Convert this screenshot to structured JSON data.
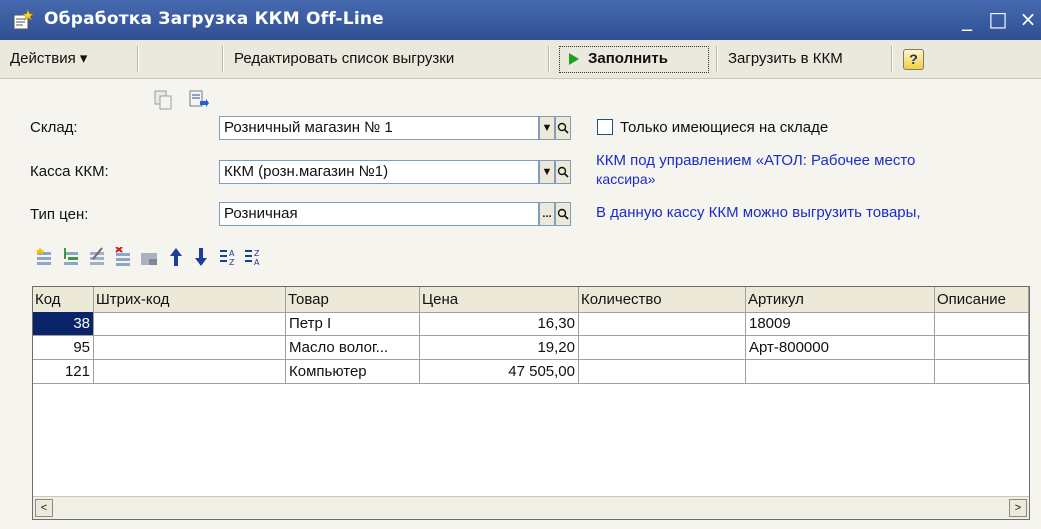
{
  "window": {
    "title": "Обработка  Загрузка ККМ Off-Line",
    "minimize": "_",
    "maximize": "□",
    "close": "×"
  },
  "toolbar": {
    "actions": "Действия ▾",
    "edit_list": "Редактировать список выгрузки",
    "fill": "Заполнить",
    "load": "Загрузить в ККМ",
    "help": "?"
  },
  "form": {
    "warehouse_label": "Склад:",
    "warehouse_value": "Розничный магазин № 1",
    "only_in_stock": "Только имеющиеся на складе",
    "cash_label": "Касса ККМ:",
    "cash_value": "ККМ (розн.магазин №1)",
    "cash_info_1": "ККМ под управлением «АТОЛ: Рабочее место",
    "cash_info_2": "кассира»",
    "price_label": "Тип цен:",
    "price_value": "Розничная",
    "price_info": "В данную кассу ККМ можно выгрузить товары,"
  },
  "table": {
    "columns": [
      "Код",
      "Штрих-код",
      "Товар",
      "Цена",
      "Количество",
      "Артикул",
      "Описание"
    ],
    "rows": [
      {
        "code": "38",
        "barcode": "",
        "item": "Петр I",
        "price": "16,30",
        "qty": "",
        "article": "18009",
        "desc": ""
      },
      {
        "code": "95",
        "barcode": "",
        "item": "Масло волог...",
        "price": "19,20",
        "qty": "",
        "article": "Арт-800000",
        "desc": ""
      },
      {
        "code": "121",
        "barcode": "",
        "item": "Компьютер",
        "price": "47 505,00",
        "qty": "",
        "article": "",
        "desc": ""
      }
    ]
  },
  "icons": {
    "app": "form-icon",
    "copy": "copy-icon",
    "paste": "paste-icon",
    "fill": "play-icon",
    "row_tools": [
      "add-row-icon",
      "add-subrow-icon",
      "edit-row-icon",
      "delete-row-icon",
      "end-edit-icon",
      "move-up-icon",
      "move-down-icon",
      "sort-asc-icon",
      "sort-desc-icon"
    ]
  },
  "colors": {
    "titlebar": "#2f4f93",
    "info_text": "#1a2dc8",
    "selection": "#0a246a",
    "fill_icon": "#1aa21a"
  }
}
